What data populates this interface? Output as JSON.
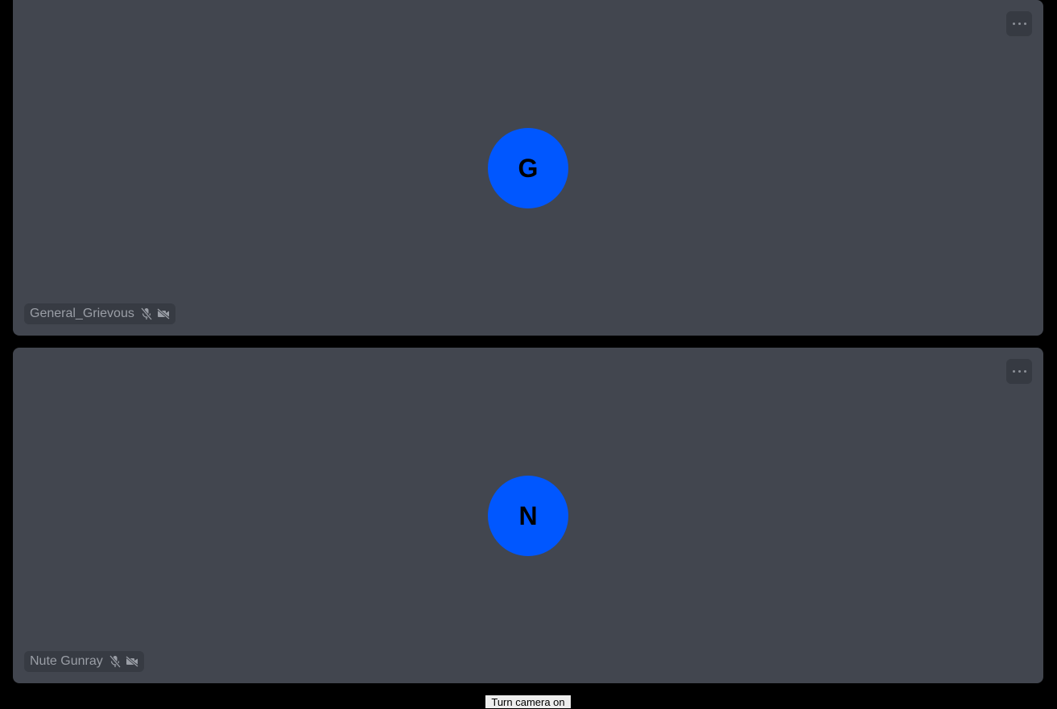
{
  "participants": [
    {
      "name": "General_Grievous",
      "initial": "G",
      "avatar_color": "#0057ff",
      "mic": "muted",
      "camera": "off"
    },
    {
      "name": "Nute Gunray",
      "initial": "N",
      "avatar_color": "#0057ff",
      "mic": "muted",
      "camera": "off"
    }
  ],
  "tooltip": "Turn camera on"
}
